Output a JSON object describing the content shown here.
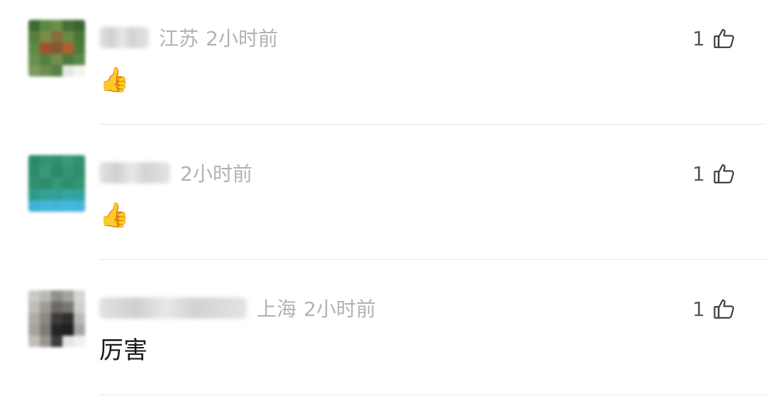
{
  "comments": [
    {
      "region": "江苏",
      "time": "2小时前",
      "content": "👍",
      "like_count": "1"
    },
    {
      "region": "",
      "time": "2小时前",
      "content": "👍",
      "like_count": "1"
    },
    {
      "region": "上海",
      "time": "2小时前",
      "content": "厉害",
      "like_count": "1"
    }
  ]
}
